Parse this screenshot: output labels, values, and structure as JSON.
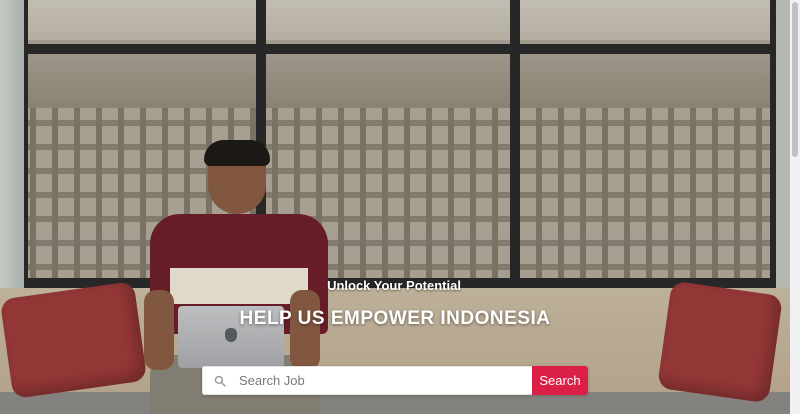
{
  "hero": {
    "tagline": "Unlock Your Potential",
    "headline": "HELP US EMPOWER INDONESIA"
  },
  "search": {
    "placeholder": "Search Job",
    "icon": "search-icon",
    "button_label": "Search",
    "button_color": "#dc1f47"
  },
  "scrollbar": {
    "visible": true
  }
}
